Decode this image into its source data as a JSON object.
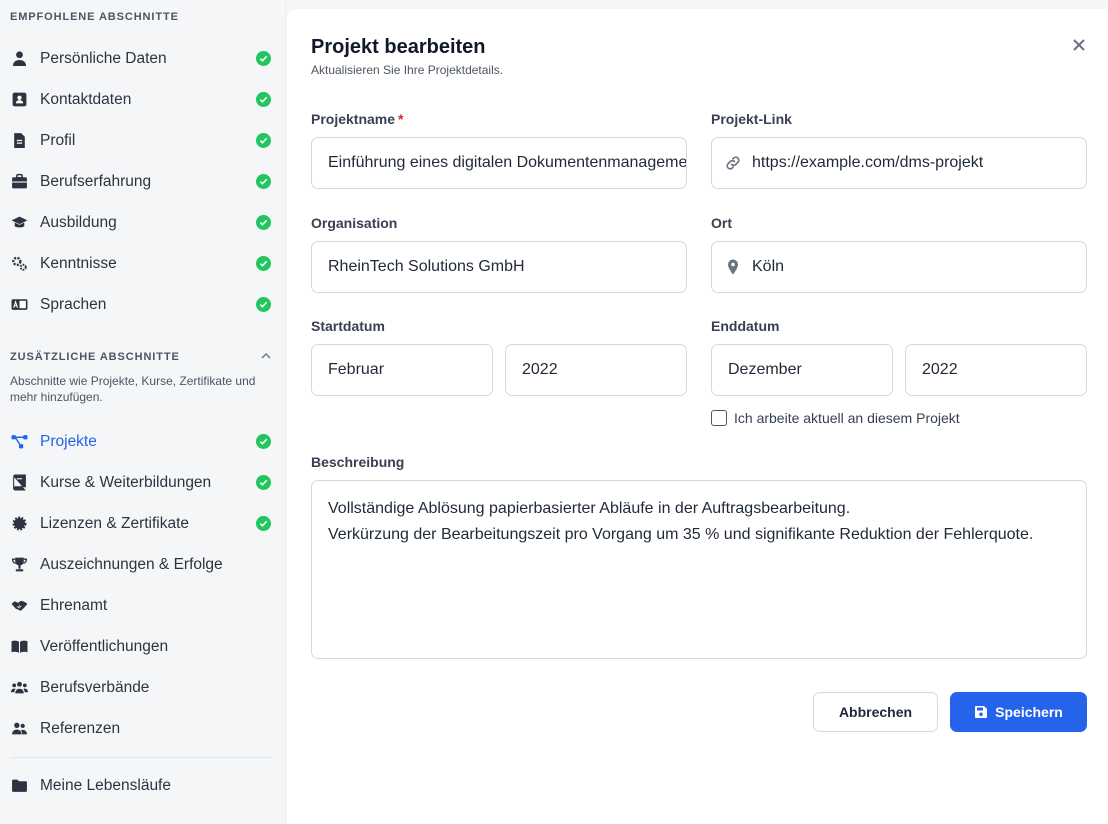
{
  "sidebar": {
    "recommended_heading": "EMPFOHLENE ABSCHNITTE",
    "recommended": [
      {
        "label": "Persönliche Daten",
        "icon": "user-icon"
      },
      {
        "label": "Kontaktdaten",
        "icon": "contact-card-icon"
      },
      {
        "label": "Profil",
        "icon": "document-icon"
      },
      {
        "label": "Berufserfahrung",
        "icon": "briefcase-icon"
      },
      {
        "label": "Ausbildung",
        "icon": "graduation-cap-icon"
      },
      {
        "label": "Kenntnisse",
        "icon": "gears-icon"
      },
      {
        "label": "Sprachen",
        "icon": "language-icon"
      }
    ],
    "additional_heading": "ZUSÄTZLICHE ABSCHNITTE",
    "additional_note": "Abschnitte wie Projekte, Kurse, Zertifikate und mehr hinzufügen.",
    "additional": [
      {
        "label": "Projekte",
        "icon": "project-nodes-icon",
        "active": true,
        "done": true
      },
      {
        "label": "Kurse & Weiterbildungen",
        "icon": "book-icon",
        "done": true
      },
      {
        "label": "Lizenzen & Zertifikate",
        "icon": "certificate-icon",
        "done": true
      },
      {
        "label": "Auszeichnungen & Erfolge",
        "icon": "trophy-icon",
        "done": false
      },
      {
        "label": "Ehrenamt",
        "icon": "handshake-icon",
        "done": false
      },
      {
        "label": "Veröffentlichungen",
        "icon": "open-book-icon",
        "done": false
      },
      {
        "label": "Berufsverbände",
        "icon": "group-icon",
        "done": false
      },
      {
        "label": "Referenzen",
        "icon": "people-icon",
        "done": false
      }
    ],
    "my_resumes": "Meine Lebensläufe"
  },
  "dialog": {
    "title": "Projekt bearbeiten",
    "subtitle": "Aktualisieren Sie Ihre Projektdetails.",
    "fields": {
      "project_name_label": "Projektname",
      "required_mark": "*",
      "project_name_value": "Einführung eines digitalen Dokumentenmanagementsystems",
      "project_link_label": "Projekt-Link",
      "project_link_value": "https://example.com/dms-projekt",
      "organisation_label": "Organisation",
      "organisation_value": "RheinTech Solutions GmbH",
      "location_label": "Ort",
      "location_value": "Köln",
      "start_label": "Startdatum",
      "start_month": "Februar",
      "start_year": "2022",
      "end_label": "Enddatum",
      "end_month": "Dezember",
      "end_year": "2022",
      "current_checkbox_label": "Ich arbeite aktuell an diesem Projekt",
      "description_label": "Beschreibung",
      "description_line1": "Vollständige Ablösung papierbasierter Abläufe in der Auftragsbearbeitung.",
      "description_line2": "Verkürzung der Bearbeitungszeit pro Vorgang um 35 % und signifikante Reduktion der Fehlerquote."
    },
    "cancel_label": "Abbrechen",
    "save_label": "Speichern"
  },
  "colors": {
    "accent": "#2563eb",
    "success": "#22c55e",
    "required": "#dc2626"
  }
}
